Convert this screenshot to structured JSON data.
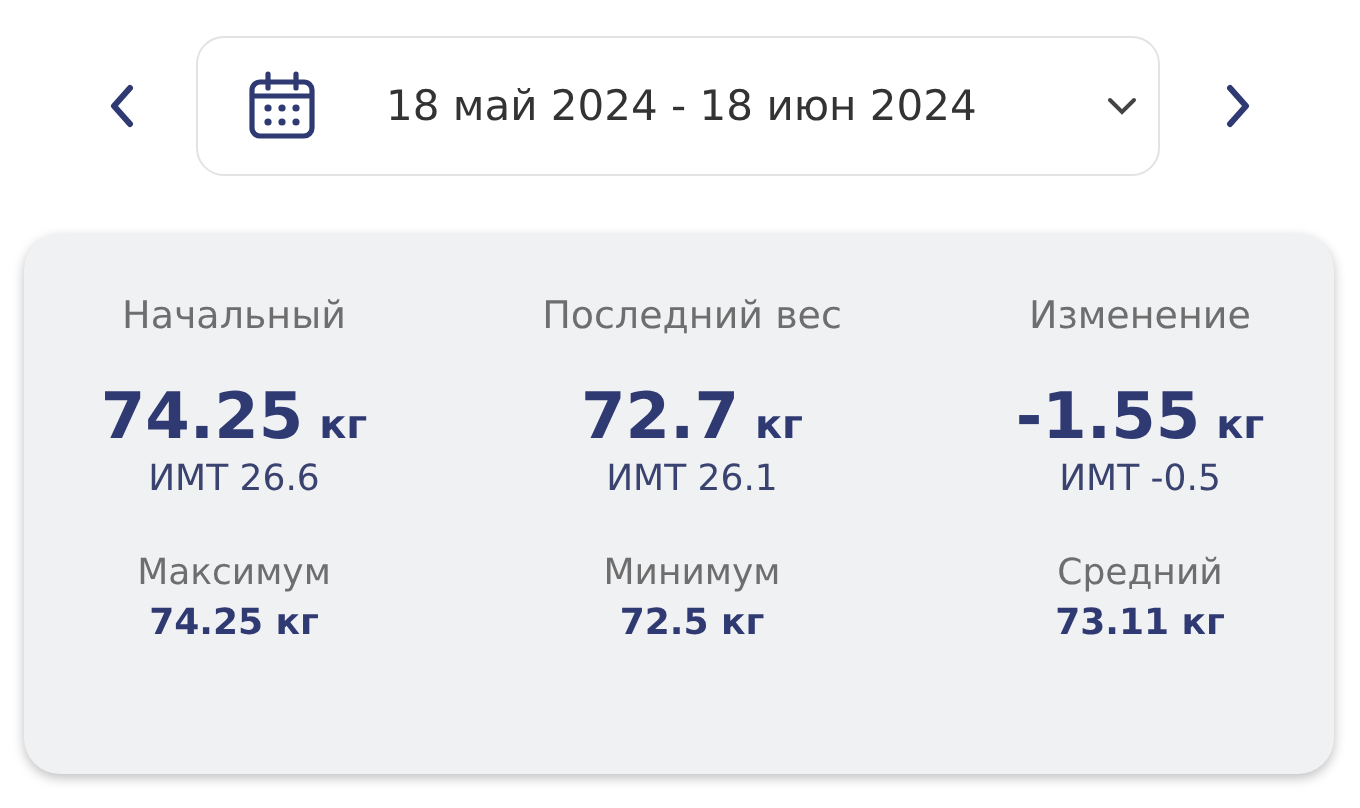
{
  "date_range": {
    "label": "18 май 2024 - 18 июн 2024"
  },
  "summary": [
    {
      "title": "Начальный",
      "value": "74.25",
      "unit": "кг",
      "bmi": "ИМТ 26.6"
    },
    {
      "title": "Последний вес",
      "value": "72.7",
      "unit": "кг",
      "bmi": "ИМТ 26.1"
    },
    {
      "title": "Изменение",
      "value": "-1.55",
      "unit": "кг",
      "bmi": "ИМТ -0.5"
    }
  ],
  "stats": [
    {
      "title": "Максимум",
      "value": "74.25 кг"
    },
    {
      "title": "Минимум",
      "value": "72.5 кг"
    },
    {
      "title": "Средний",
      "value": "73.11 кг"
    }
  ]
}
